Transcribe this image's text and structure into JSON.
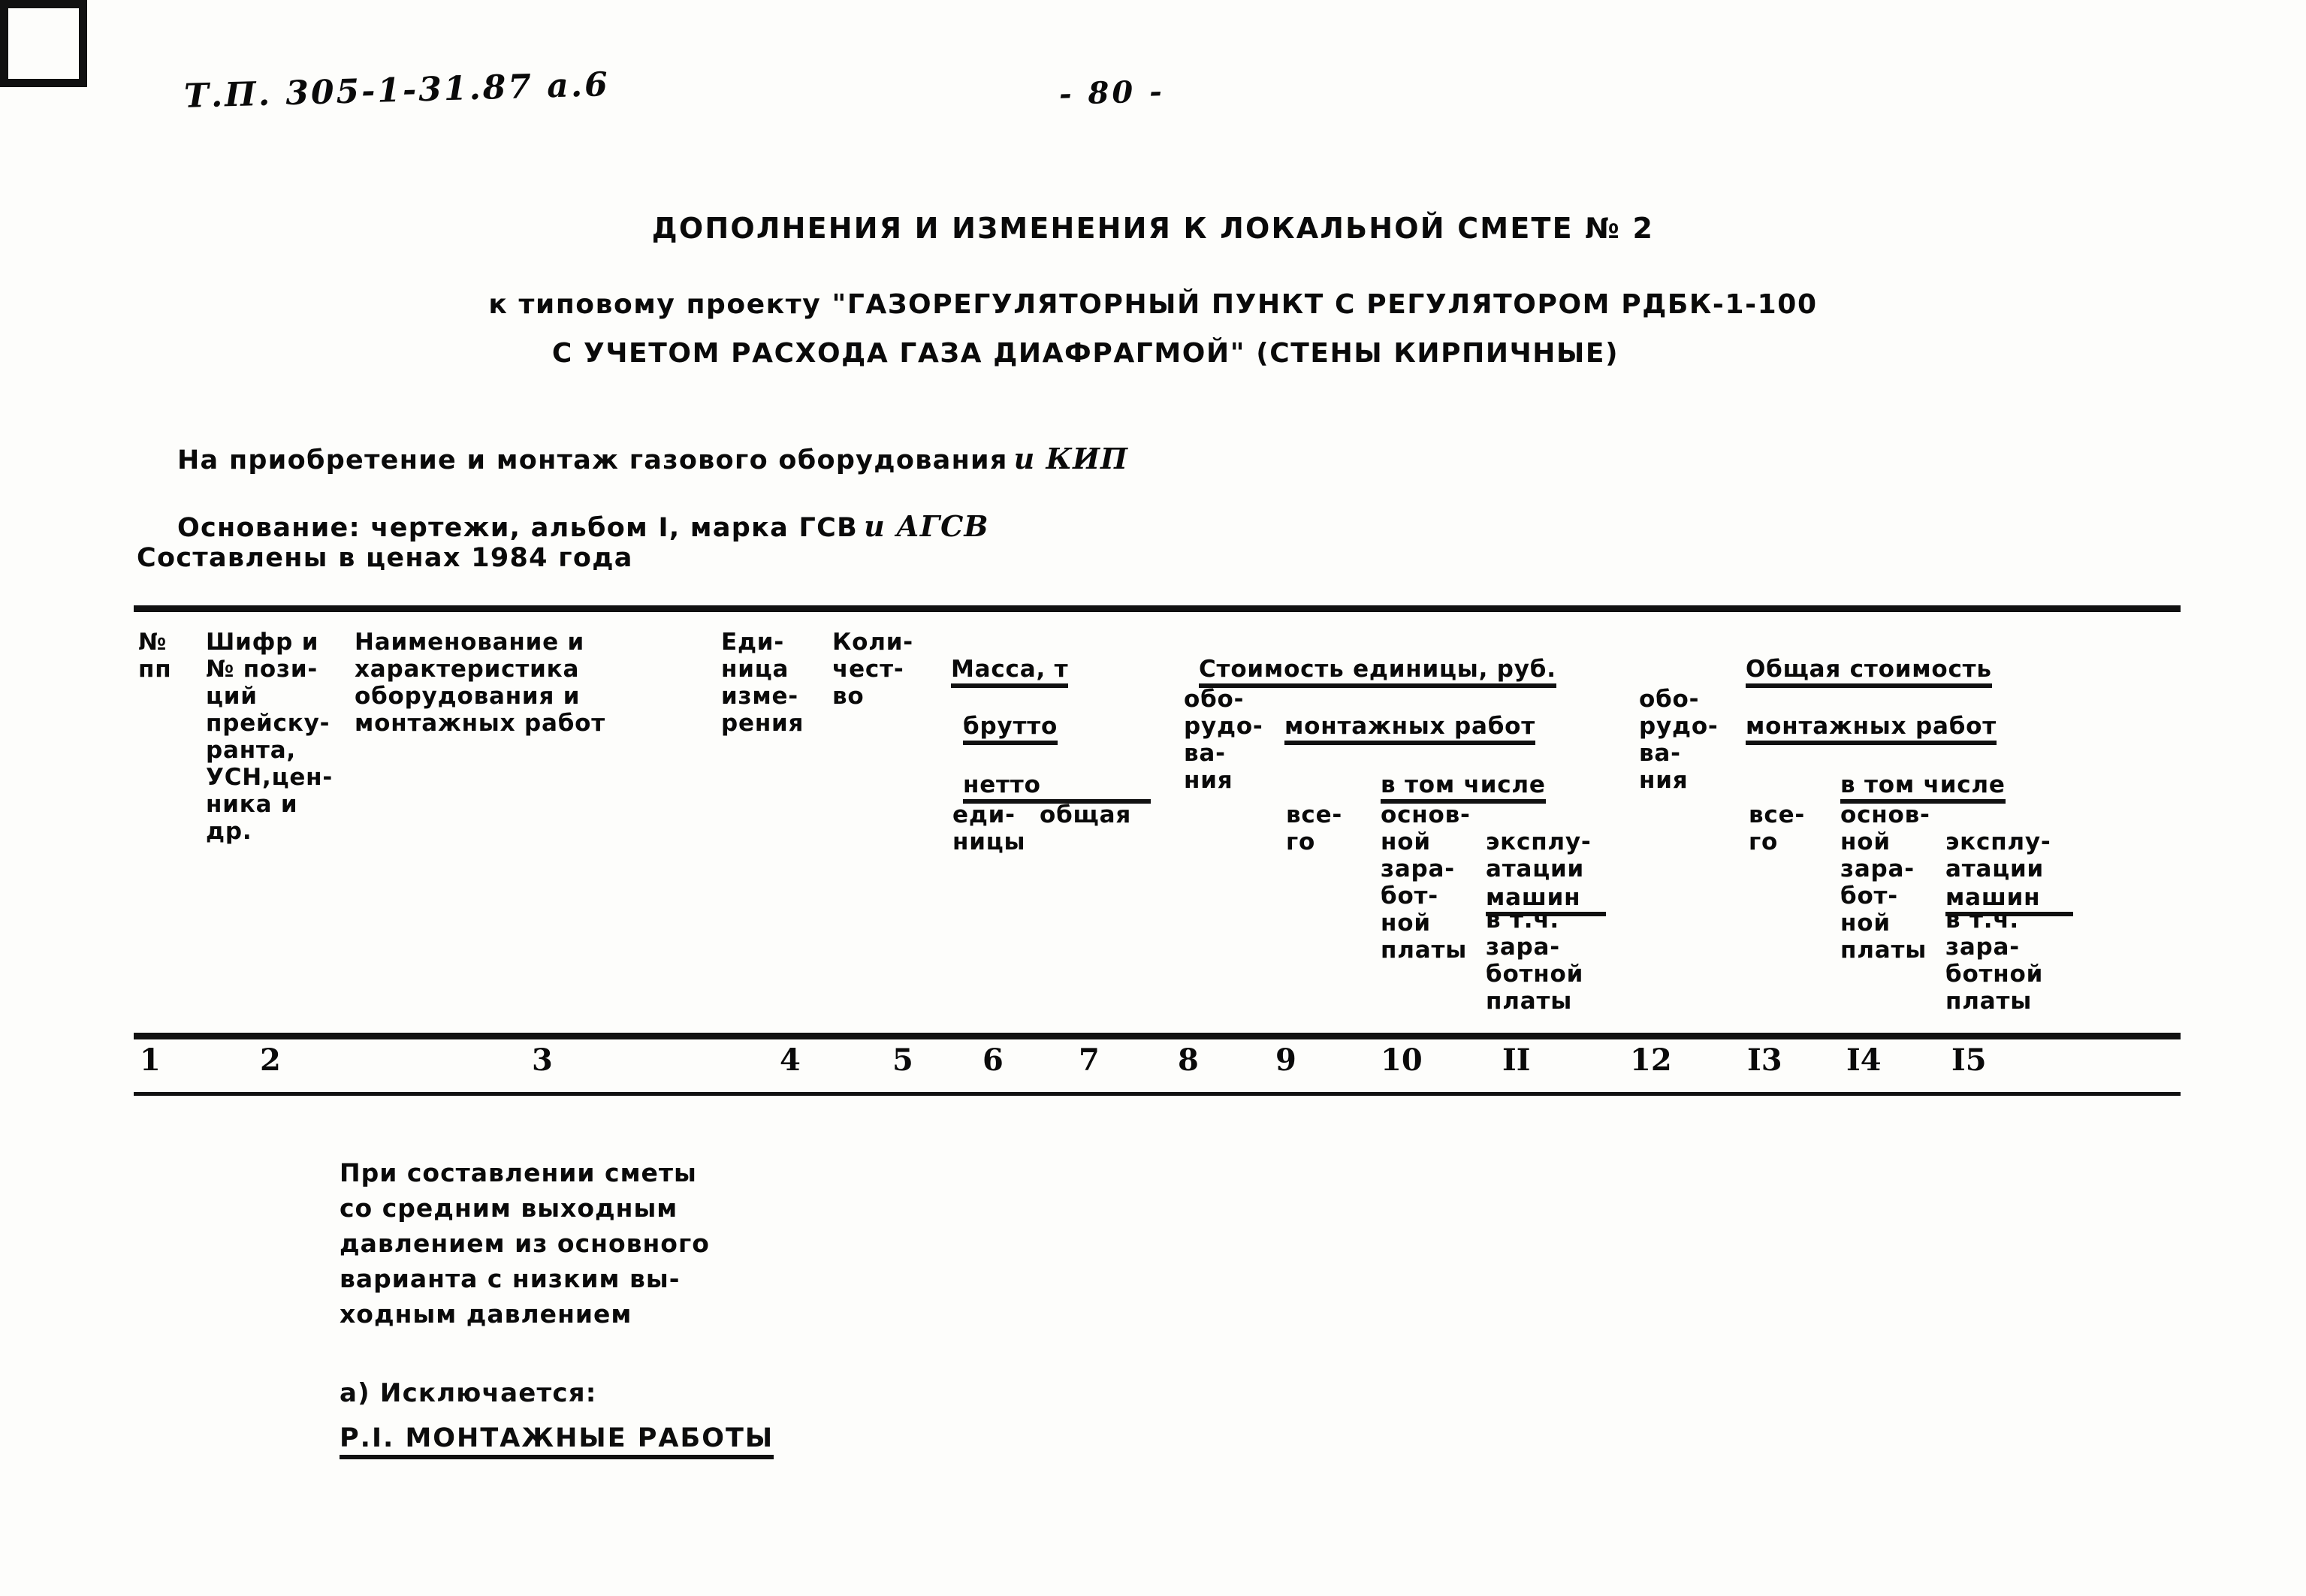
{
  "registration_marks": [
    "top-left",
    "top-right",
    "bottom-left",
    "bottom-right"
  ],
  "header": {
    "handwritten_code": "Т.П. 305-1-31.87 а.6",
    "page_number": "- 80 -"
  },
  "title": {
    "main": "ДОПОЛНЕНИЯ И ИЗМЕНЕНИЯ К ЛОКАЛЬНОЙ СМЕТЕ № 2",
    "subtitle_line1": "к типовому проекту \"ГАЗОРЕГУЛЯТОРНЫЙ ПУНКТ С РЕГУЛЯТОРОМ РДБК-1-100",
    "subtitle_line2": "С УЧЕТОМ РАСХОДА ГАЗА ДИАФРАГМОЙ\" (СТЕНЫ КИРПИЧНЫЕ)"
  },
  "preamble": {
    "purpose_typed": "На приобретение и монтаж газового оборудования",
    "purpose_hand": "и КИП",
    "basis_typed": "Основание: чертежи, альбом I, марка ГСВ",
    "basis_hand": "и АГСВ",
    "prices": "Составлены в ценах 1984 года"
  },
  "table": {
    "headers": {
      "c1": "№\nпп",
      "c2": "Шифр и\n№ пози-\nций\nпрейску-\nранта,\nУСН,цен-\nника и\nдр.",
      "c3": "Наименование и\nхарактеристика\nоборудования и\nмонтажных работ",
      "c4": "Еди-\nница\nизме-\nрения",
      "c5": "Коли-\nчест-\nво",
      "mass_group": "Масса, т",
      "mass_brutto": "брутто",
      "mass_netto": "нетто",
      "c6": "еди-\nницы",
      "c7": "общая",
      "unit_cost_group": "Стоимость единицы, руб.",
      "c8": "обо-\nрудо-\nва-\nния",
      "install_group_a": "монтажных работ",
      "c9": "все-\nго",
      "in_which_a": "в том числе",
      "c10": "основ-\nной\nзара-\nбот-\nной\nплаты",
      "c11": "эксплу-\nатации",
      "c11_ul": "машин",
      "c11_tail": "в т.ч.\nзара-\nботной\nплаты",
      "total_cost_group": "Общая стоимость",
      "c12": "обо-\nрудо-\nва-\nния",
      "install_group_b": "монтажных работ",
      "c13": "все-\nго",
      "in_which_b": "в том числе",
      "c14": "основ-\nной\nзара-\nбот-\nной\nплаты",
      "c15": "эксплу-\nатации",
      "c15_ul": "машин",
      "c15_tail": "в т.ч.\nзара-\nботной\nплаты"
    },
    "column_numbers": [
      "1",
      "2",
      "3",
      "4",
      "5",
      "6",
      "7",
      "8",
      "9",
      "10",
      "II",
      "12",
      "I3",
      "I4",
      "I5"
    ]
  },
  "notes": {
    "condition": "При составлении сметы\nсо средним выходным\nдавлением из основного\nварианта с низким вы-\nходным давлением",
    "excluded_label": "а) Исключается:",
    "excluded_section": "Р.I. МОНТАЖНЫЕ РАБОТЫ"
  }
}
